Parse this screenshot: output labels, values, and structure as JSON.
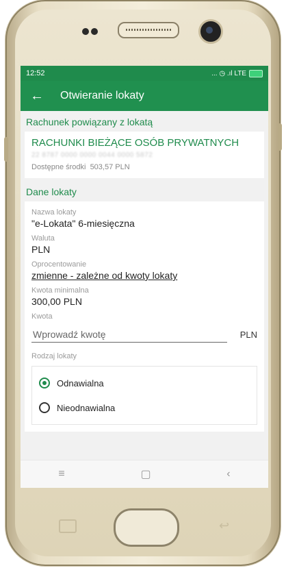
{
  "status_bar": {
    "time": "12:52",
    "indicators": "... ◷ .ıl LTE"
  },
  "app_bar": {
    "back_icon": "arrow-left-icon",
    "title": "Otwieranie lokaty"
  },
  "linked_account": {
    "section_title": "Rachunek powiązany z lokatą",
    "account_name": "RACHUNKI BIEŻĄCE OSÓB PRYWATNYCH",
    "account_number": "22 8787 0000 0000 0044 0000 5872",
    "available_label": "Dostępne środki",
    "available_value": "503,57 PLN"
  },
  "deposit": {
    "section_title": "Dane lokaty",
    "name_label": "Nazwa lokaty",
    "name_value": "\"e-Lokata\" 6-miesięczna",
    "currency_label": "Waluta",
    "currency_value": "PLN",
    "interest_label": "Oprocentowanie",
    "interest_value": "zmienne - zależne od kwoty lokaty",
    "min_amount_label": "Kwota minimalna",
    "min_amount_value": "300,00 PLN",
    "amount_label": "Kwota",
    "amount_placeholder": "Wprowadź kwotę",
    "amount_currency": "PLN",
    "type_label": "Rodzaj lokaty",
    "type_options": [
      "Odnawialna",
      "Nieodnawialna"
    ],
    "type_selected": "Odnawialna"
  },
  "colors": {
    "brand_green": "#20904f",
    "status_green": "#1f8b4c"
  },
  "nav_bar": {
    "menu_icon": "menu-icon",
    "home_icon": "square-icon",
    "back_icon": "chevron-left-icon"
  }
}
